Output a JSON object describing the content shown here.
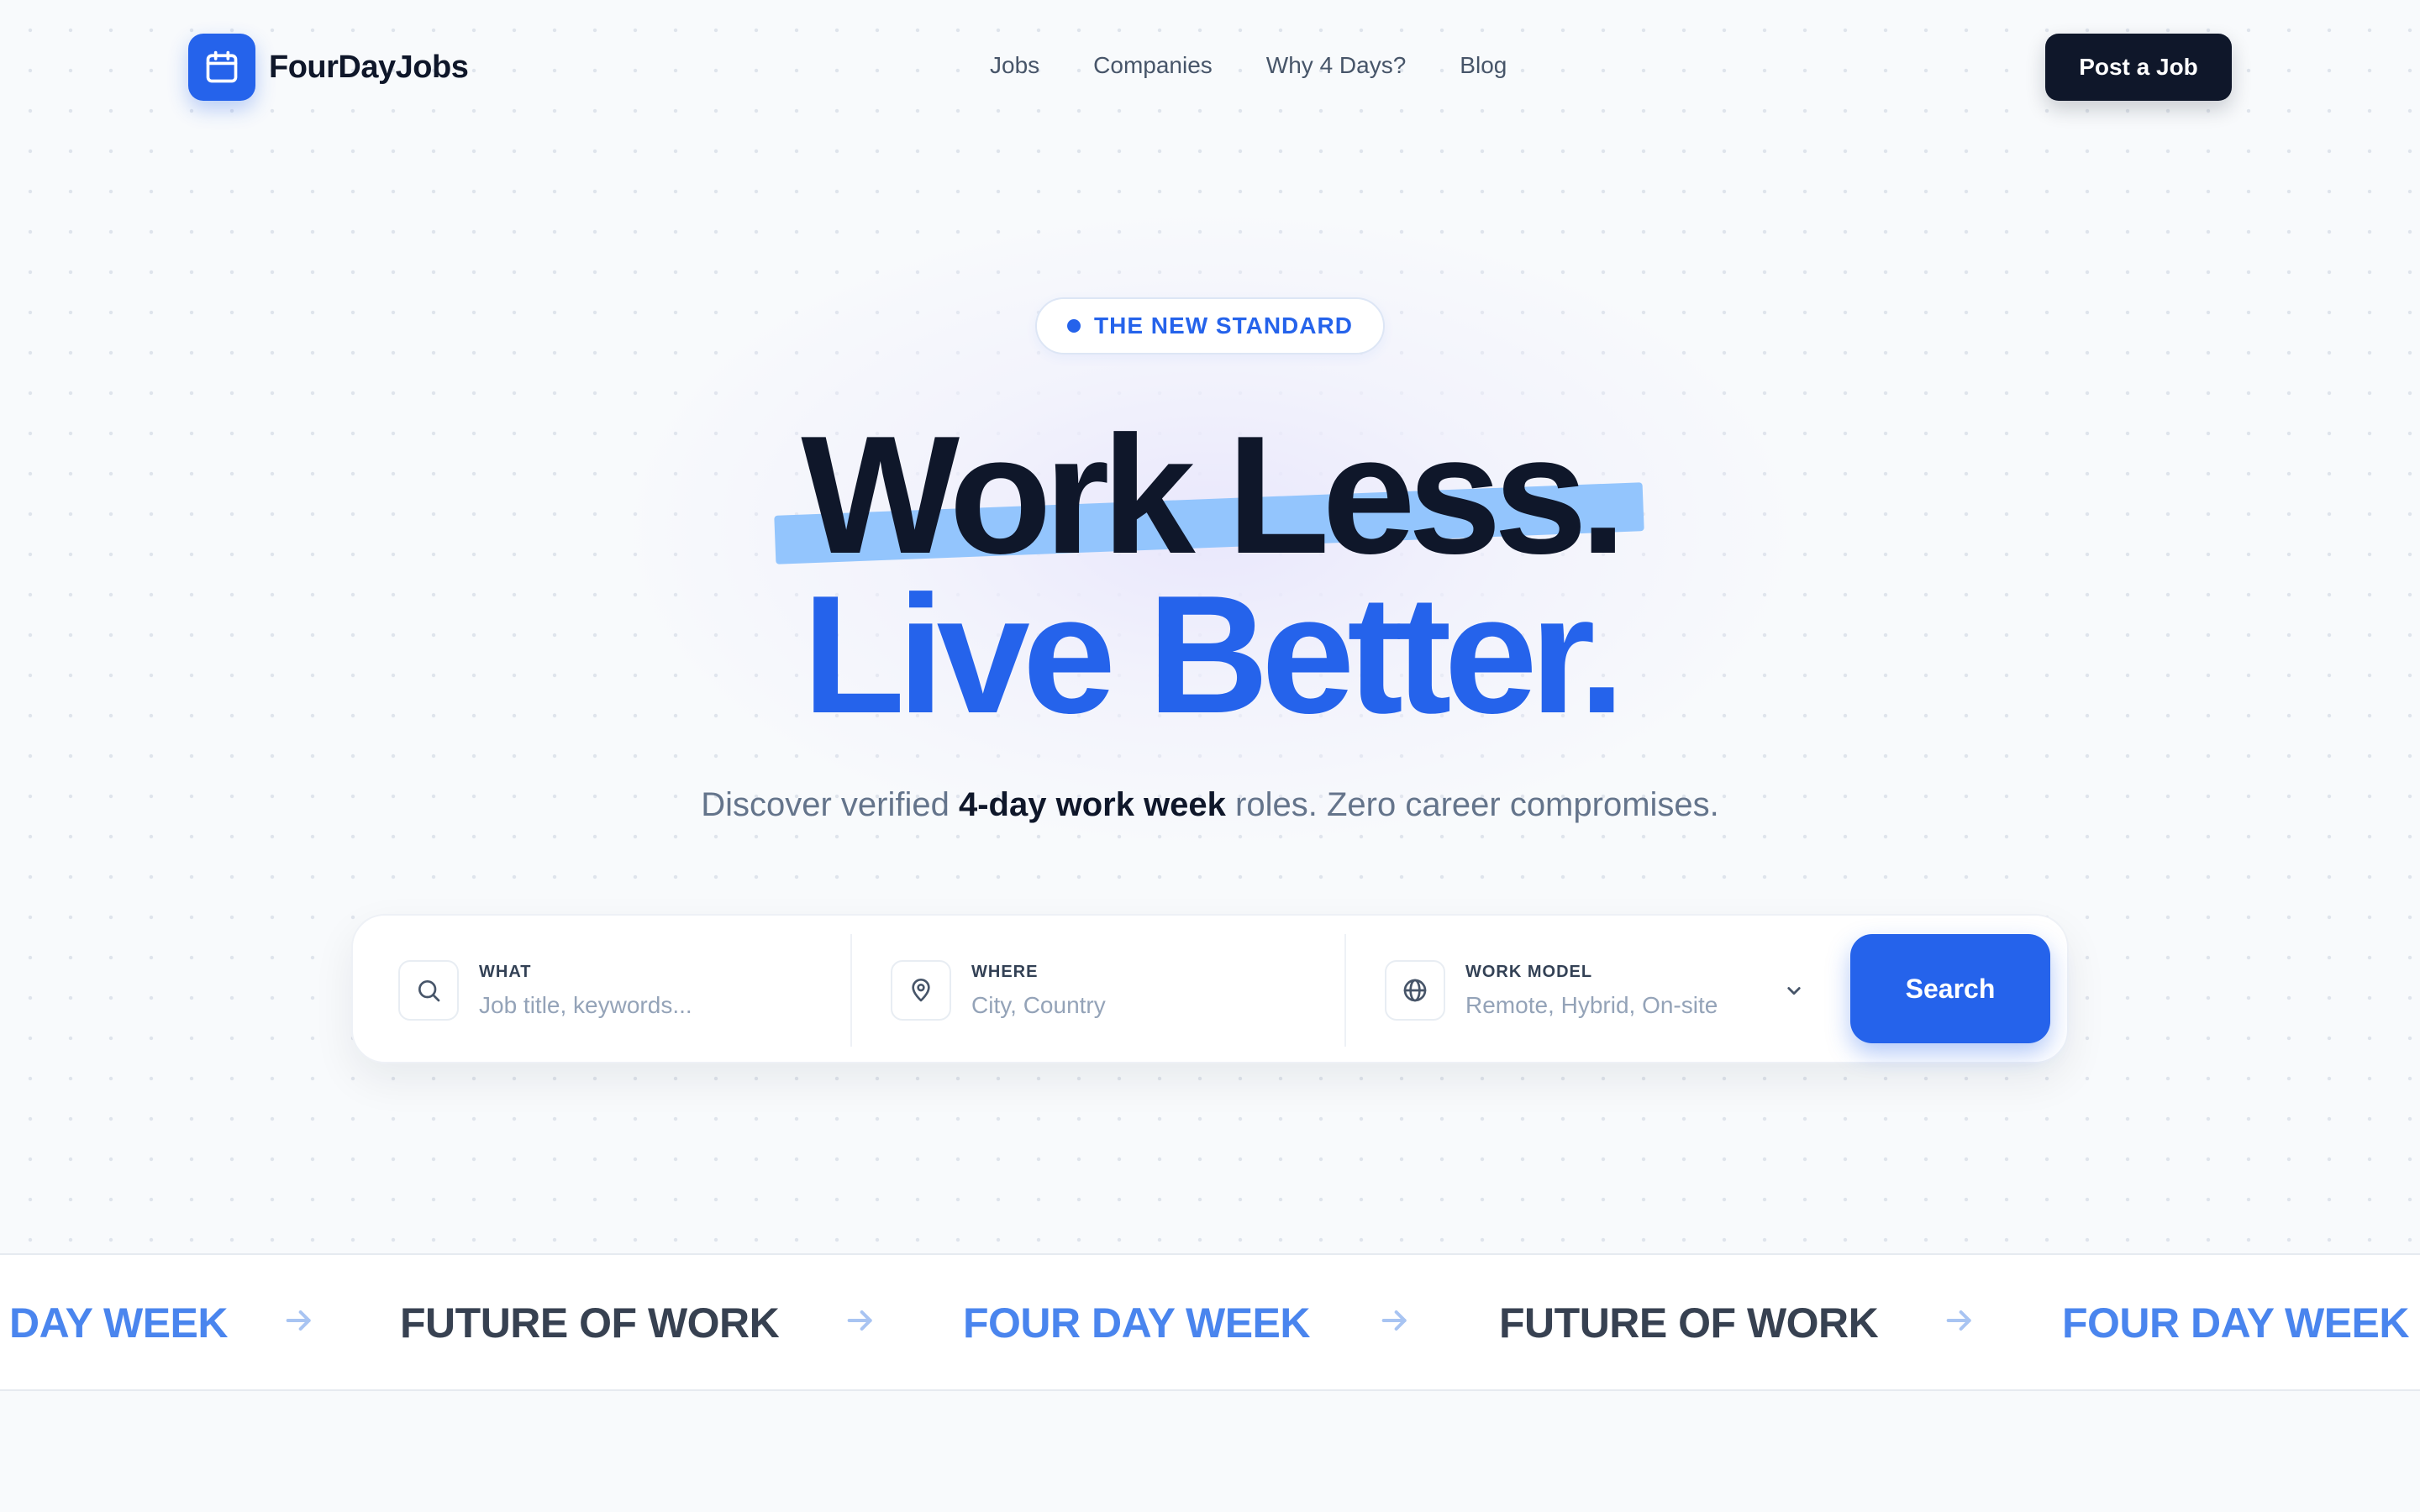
{
  "brand": {
    "name": "FourDayJobs",
    "icon": "calendar-icon",
    "color": "#2563eb"
  },
  "nav": {
    "links": [
      "Jobs",
      "Companies",
      "Why 4 Days?",
      "Blog"
    ],
    "cta": "Post a Job"
  },
  "hero": {
    "badge": "THE NEW STANDARD",
    "headline_line1": "Work Less.",
    "headline_line2": "Live Better.",
    "subtitle_before": "Discover verified ",
    "subtitle_bold": "4-day work week",
    "subtitle_after": " roles. Zero career compromises."
  },
  "search": {
    "what": {
      "label": "WHAT",
      "placeholder": "Job title, keywords...",
      "icon": "search-icon"
    },
    "where": {
      "label": "WHERE",
      "placeholder": "City, Country",
      "icon": "map-pin-icon"
    },
    "work_model": {
      "label": "WORK MODEL",
      "value": "Remote, Hybrid, On-site",
      "icon": "globe-icon"
    },
    "button": "Search"
  },
  "marquee": {
    "items": [
      "FOUR DAY WEEK",
      "FUTURE OF WORK",
      "FOUR DAY WEEK",
      "FUTURE OF WORK",
      "FOUR DAY WEEK"
    ],
    "separator_icon": "arrow-right-icon"
  },
  "colors": {
    "accent": "#2563eb",
    "dark": "#0f172a",
    "highlight": "#93c5fd"
  }
}
